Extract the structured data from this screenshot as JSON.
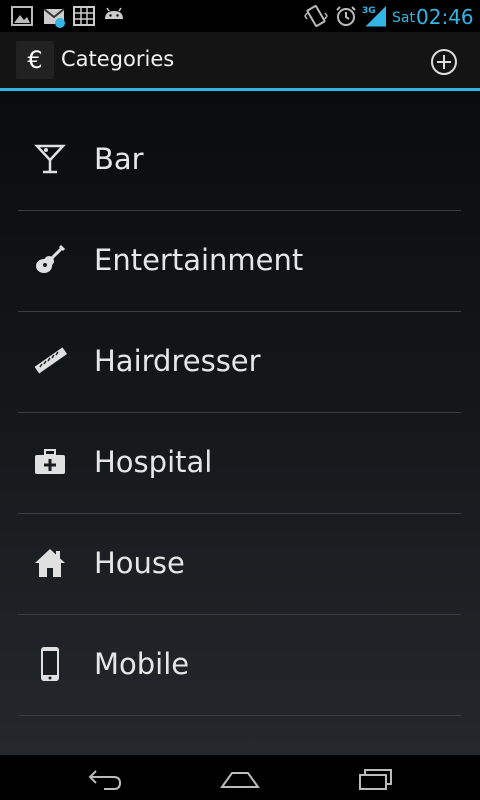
{
  "status_bar": {
    "network": "3G",
    "day": "Sat",
    "time": "02:46"
  },
  "action_bar": {
    "app_icon": "€",
    "title": "Categories"
  },
  "categories": [
    {
      "label": "Bar",
      "icon": "cocktail-icon"
    },
    {
      "label": "Entertainment",
      "icon": "guitar-icon"
    },
    {
      "label": "Hairdresser",
      "icon": "ruler-icon"
    },
    {
      "label": "Hospital",
      "icon": "medical-kit-icon"
    },
    {
      "label": "House",
      "icon": "house-icon"
    },
    {
      "label": "Mobile",
      "icon": "mobile-phone-icon"
    }
  ],
  "colors": {
    "accent": "#33b5e5",
    "text": "#e6e6e6",
    "divider": "#3a3d40"
  }
}
